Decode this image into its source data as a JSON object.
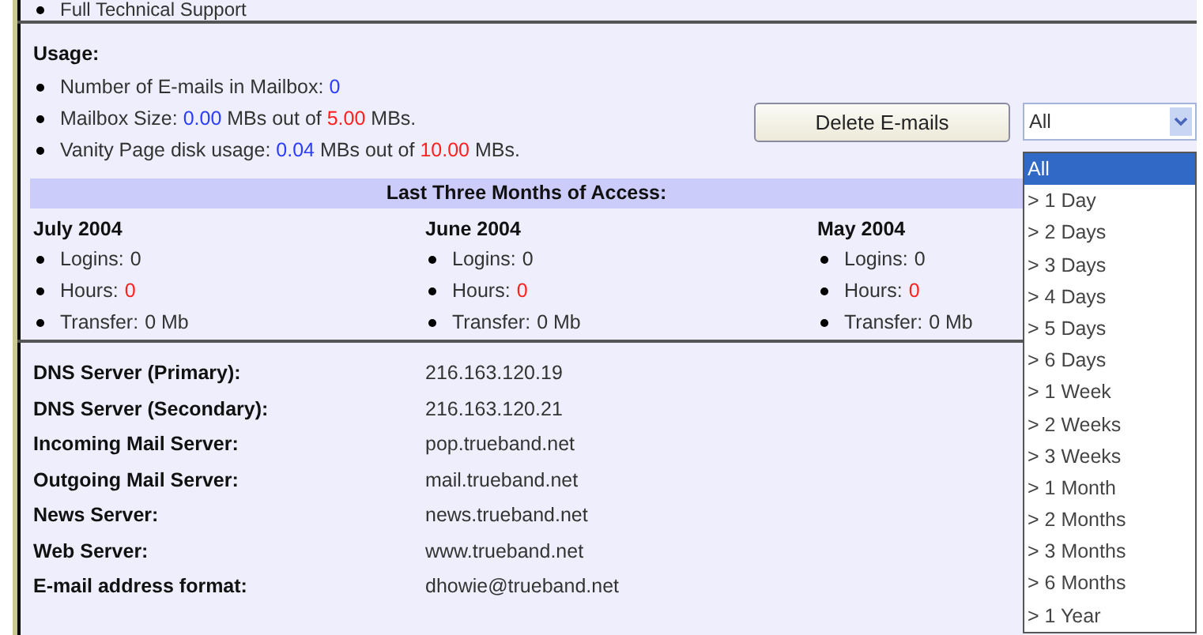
{
  "top_item": "Full Technical Support",
  "usage": {
    "title": "Usage:",
    "items": [
      [
        {
          "text": "Number of E-mails in Mailbox: ",
          "kind": "plain"
        },
        {
          "text": "0",
          "kind": "used"
        }
      ],
      [
        {
          "text": "Mailbox Size: ",
          "kind": "plain"
        },
        {
          "text": "0.00",
          "kind": "used"
        },
        {
          "text": " MBs out of ",
          "kind": "plain"
        },
        {
          "text": "5.00",
          "kind": "limit"
        },
        {
          "text": " MBs.",
          "kind": "plain"
        }
      ],
      [
        {
          "text": "Vanity Page disk usage: ",
          "kind": "plain"
        },
        {
          "text": "0.04",
          "kind": "used"
        },
        {
          "text": " MBs out of ",
          "kind": "plain"
        },
        {
          "text": "10.00",
          "kind": "limit"
        },
        {
          "text": " MBs.",
          "kind": "plain"
        }
      ]
    ]
  },
  "delete_button": "Delete E-mails",
  "period_select": {
    "value": "All",
    "options": [
      {
        "label": "All",
        "selected": true
      },
      {
        "label": "> 1 Day",
        "selected": false
      },
      {
        "label": "> 2 Days",
        "selected": false
      },
      {
        "label": "> 3 Days",
        "selected": false
      },
      {
        "label": "> 4 Days",
        "selected": false
      },
      {
        "label": "> 5 Days",
        "selected": false
      },
      {
        "label": "> 6 Days",
        "selected": false
      },
      {
        "label": "> 1 Week",
        "selected": false
      },
      {
        "label": "> 2 Weeks",
        "selected": false
      },
      {
        "label": "> 3 Weeks",
        "selected": false
      },
      {
        "label": "> 1 Month",
        "selected": false
      },
      {
        "label": "> 2 Months",
        "selected": false
      },
      {
        "label": "> 3 Months",
        "selected": false
      },
      {
        "label": "> 6 Months",
        "selected": false
      },
      {
        "label": "> 1 Year",
        "selected": false
      }
    ]
  },
  "access": {
    "title": "Last Three Months of Access:",
    "months": [
      {
        "name": "July 2004",
        "stats": [
          {
            "label": "Logins:",
            "value": "0",
            "alert": false
          },
          {
            "label": "Hours:",
            "value": "0",
            "alert": true
          },
          {
            "label": "Transfer:",
            "value": "0 Mb",
            "alert": false
          }
        ]
      },
      {
        "name": "June 2004",
        "stats": [
          {
            "label": "Logins:",
            "value": "0",
            "alert": false
          },
          {
            "label": "Hours:",
            "value": "0",
            "alert": true
          },
          {
            "label": "Transfer:",
            "value": "0 Mb",
            "alert": false
          }
        ]
      },
      {
        "name": "May 2004",
        "stats": [
          {
            "label": "Logins:",
            "value": "0",
            "alert": false
          },
          {
            "label": "Hours:",
            "value": "0",
            "alert": true
          },
          {
            "label": "Transfer:",
            "value": "0 Mb",
            "alert": false
          }
        ]
      }
    ]
  },
  "servers": [
    {
      "label": "DNS Server (Primary):",
      "value": "216.163.120.19"
    },
    {
      "label": "DNS Server (Secondary):",
      "value": "216.163.120.21"
    },
    {
      "label": "Incoming Mail Server:",
      "value": "pop.trueband.net"
    },
    {
      "label": "Outgoing Mail Server:",
      "value": "mail.trueband.net"
    },
    {
      "label": "News Server:",
      "value": "news.trueband.net"
    },
    {
      "label": "Web Server:",
      "value": "www.trueband.net"
    },
    {
      "label": "E-mail address format:",
      "value": "dhowie@trueband.net"
    }
  ]
}
